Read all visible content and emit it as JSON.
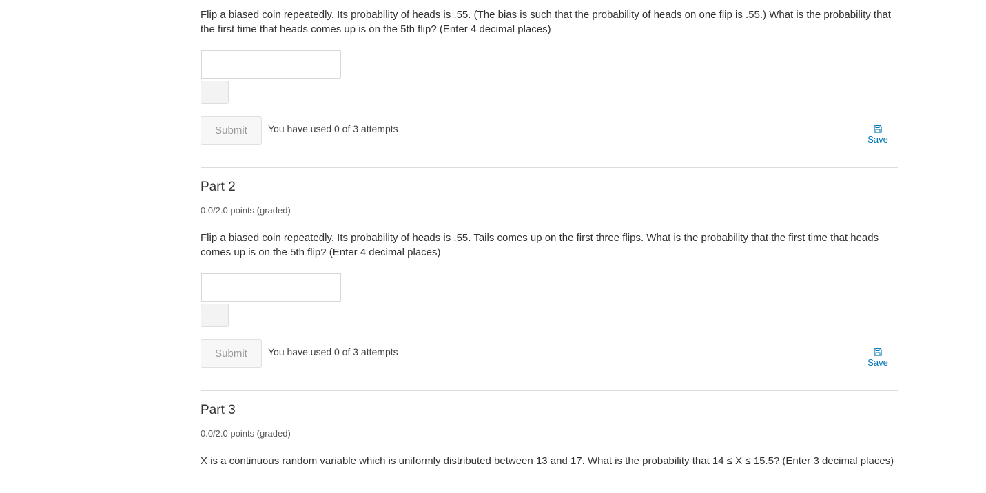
{
  "part1": {
    "question": "Flip a biased coin repeatedly. Its probability of heads is .55. (The bias is such that the probability of heads on one flip is .55.) What is the probability that the first time that heads comes up is on the 5th flip? (Enter 4 decimal places)",
    "answer_value": "",
    "submit_label": "Submit",
    "attempts_text": "You have used 0 of 3 attempts",
    "save_label": "Save"
  },
  "part2": {
    "title": "Part 2",
    "points": "0.0/2.0 points (graded)",
    "question": "Flip a biased coin repeatedly. Its probability of heads is .55. Tails comes up on the first three flips. What is the probability that the first time that heads comes up is on the 5th flip? (Enter 4 decimal places)",
    "answer_value": "",
    "submit_label": "Submit",
    "attempts_text": "You have used 0 of 3 attempts",
    "save_label": "Save"
  },
  "part3": {
    "title": "Part 3",
    "points": "0.0/2.0 points (graded)",
    "question": "X is a continuous random variable which is uniformly distributed between 13 and 17. What is the probability that 14 ≤ X ≤ 15.5? (Enter 3 decimal places)"
  },
  "colors": {
    "link": "#0075b4",
    "text": "#313131",
    "submit_disabled_text": "#9a9a9a"
  },
  "icons": {
    "save": "save-icon"
  }
}
